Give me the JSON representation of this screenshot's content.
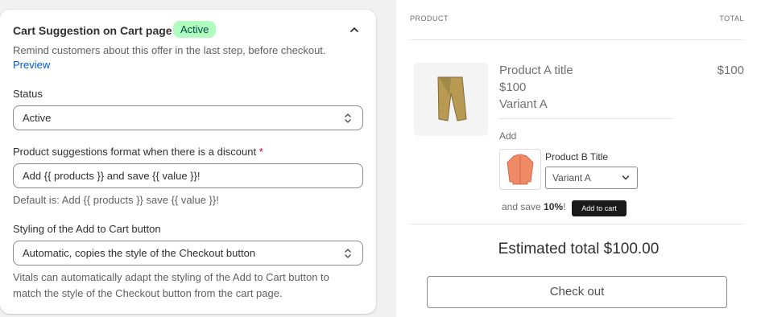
{
  "settings": {
    "title": "Cart Suggestion on Cart page",
    "badge": "Active",
    "description": "Remind customers about this offer in the last step, before checkout.",
    "preview_link": "Preview",
    "status": {
      "label": "Status",
      "value": "Active"
    },
    "format": {
      "label": "Product suggestions format when there is a discount",
      "required_mark": "*",
      "value": "Add {{ products }} and save {{ value }}!",
      "help": "Default is: Add {{ products }} save {{ value }}!"
    },
    "styling": {
      "label": "Styling of the Add to Cart button",
      "value": "Automatic, copies the style of the Checkout button",
      "help_line1": "Vitals can automatically adapt the styling of the Add to Cart button to",
      "help_line2": "match the style of the Checkout button from the cart page."
    }
  },
  "cart_preview": {
    "header_product": "PRODUCT",
    "header_total": "TOTAL",
    "item": {
      "title": "Product A title",
      "price": "$100",
      "variant": "Variant A",
      "total": "$100",
      "image_icon": "pants-icon"
    },
    "suggestion": {
      "add_label": "Add",
      "product_title": "Product B Title",
      "variant": "Variant A",
      "save_prefix": "and save",
      "save_value": "10%",
      "save_suffix": "!",
      "button": "Add to cart",
      "image_icon": "shirt-icon"
    },
    "estimated_total": "Estimated total $100.00",
    "checkout_button": "Check out"
  },
  "colors": {
    "badge_bg": "#affebf",
    "badge_text": "#014b40",
    "link": "#005bd3",
    "required": "#c70a24"
  }
}
